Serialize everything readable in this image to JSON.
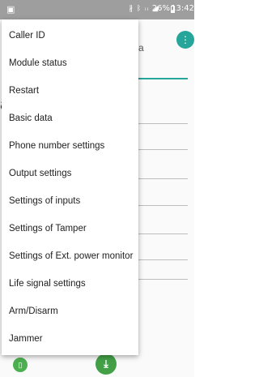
{
  "status_bar": {
    "left_icon": "image-icon",
    "icons_text": "∦ ᛒ ᵢᵢ ◢",
    "battery_pct": "26%",
    "time": "13:42"
  },
  "background": {
    "partial_letter_a": "a",
    "partial_title": "a"
  },
  "menu": {
    "items": [
      {
        "label": "Caller ID"
      },
      {
        "label": "Module status"
      },
      {
        "label": "Restart"
      },
      {
        "label": "Basic data"
      },
      {
        "label": "Phone number settings"
      },
      {
        "label": "Output settings"
      },
      {
        "label": "Settings of inputs"
      },
      {
        "label": "Settings of Tamper"
      },
      {
        "label": "Settings of Ext. power monitor"
      },
      {
        "label": "Life signal settings"
      },
      {
        "label": "Arm/Disarm"
      },
      {
        "label": "Jammer"
      }
    ]
  },
  "icons": {
    "fab_top": "overflow-icon",
    "bottom_left": "device-icon",
    "bottom_center": "download-icon"
  },
  "colors": {
    "accent": "#26a69a",
    "status_bar": "#9e9e9e",
    "green": "#43a047"
  }
}
